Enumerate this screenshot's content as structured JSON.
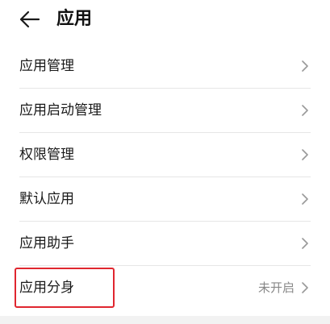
{
  "header": {
    "back_icon": "arrow-left-icon",
    "title": "应用"
  },
  "settings": {
    "items": [
      {
        "label": "应用管理",
        "icon": "chevron-right-icon"
      },
      {
        "label": "应用启动管理",
        "icon": "chevron-right-icon"
      },
      {
        "label": "权限管理",
        "icon": "chevron-right-icon"
      },
      {
        "label": "默认应用",
        "icon": "chevron-right-icon"
      },
      {
        "label": "应用助手",
        "icon": "chevron-right-icon"
      },
      {
        "label": "应用分身",
        "value": "未开启",
        "icon": "chevron-right-icon"
      }
    ]
  },
  "colors": {
    "highlight": "#e0262f",
    "divider": "#e6e6e6",
    "secondary_text": "#888888"
  }
}
